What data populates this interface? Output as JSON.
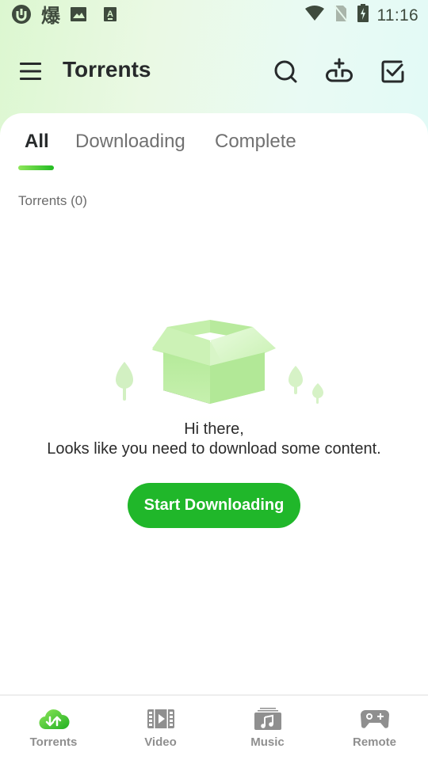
{
  "status_bar": {
    "time": "11:16",
    "cjk_glyph": "爆",
    "left_icons": [
      "utorrent-logo-icon",
      "notification-cjk-icon",
      "image-icon",
      "keyboard-a-icon"
    ],
    "right_icons": [
      "wifi-icon",
      "no-sim-icon",
      "battery-charging-icon"
    ]
  },
  "app_bar": {
    "title": "Torrents",
    "actions": [
      "search",
      "add-link",
      "select-all"
    ]
  },
  "tabs": [
    {
      "label": "All",
      "active": true
    },
    {
      "label": "Downloading",
      "active": false
    },
    {
      "label": "Complete",
      "active": false
    }
  ],
  "list": {
    "count_label": "Torrents (0)"
  },
  "empty_state": {
    "line1": "Hi there,",
    "line2": "Looks like you need to download some content.",
    "button_label": "Start Downloading"
  },
  "bottom_nav": [
    {
      "label": "Torrents",
      "icon": "cloud-transfer-icon",
      "active": true
    },
    {
      "label": "Video",
      "icon": "film-play-icon",
      "active": false
    },
    {
      "label": "Music",
      "icon": "music-library-icon",
      "active": false
    },
    {
      "label": "Remote",
      "icon": "gamepad-icon",
      "active": false
    }
  ],
  "colors": {
    "accent": "#20b72a",
    "accent_light": "#8ee65a",
    "text_primary": "#272a2b",
    "text_secondary": "#717171",
    "nav_inactive": "#8f8f8f"
  }
}
